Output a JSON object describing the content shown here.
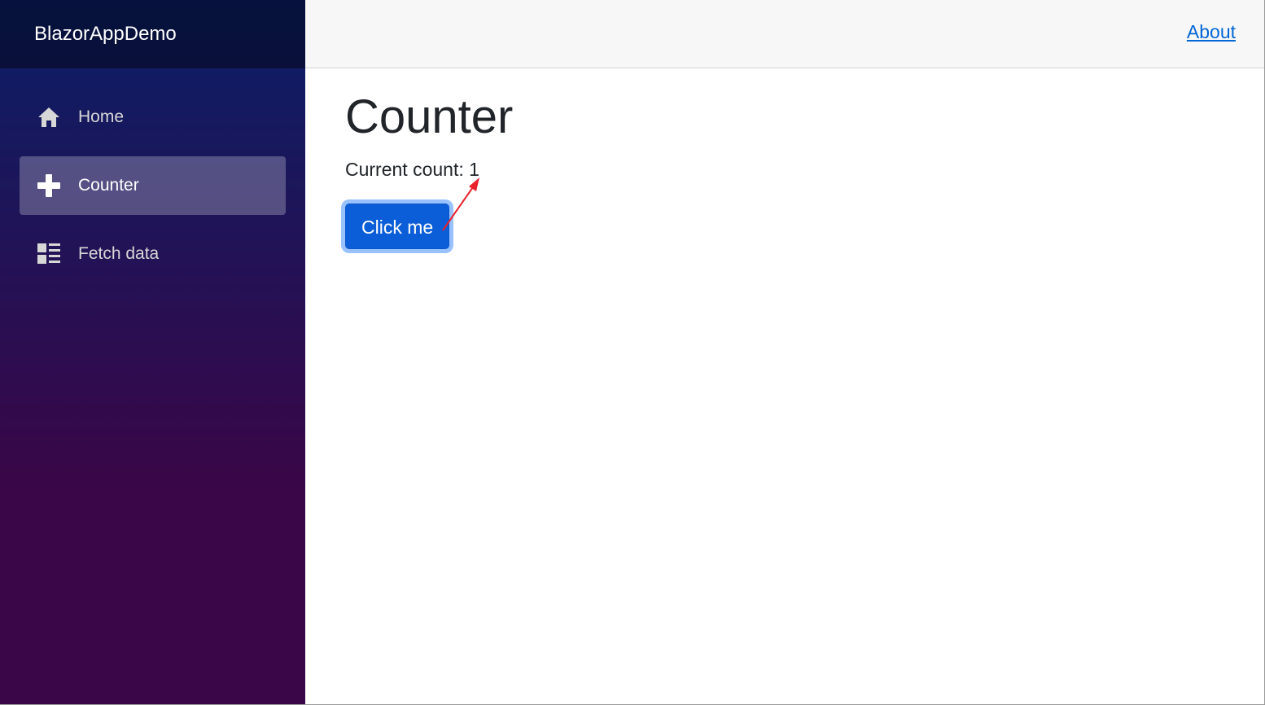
{
  "app": {
    "brand": "BlazorAppDemo"
  },
  "nav": {
    "items": [
      {
        "label": "Home",
        "icon": "home-icon",
        "active": false
      },
      {
        "label": "Counter",
        "icon": "plus-icon",
        "active": true
      },
      {
        "label": "Fetch data",
        "icon": "list-icon",
        "active": false
      }
    ]
  },
  "topbar": {
    "about_label": "About"
  },
  "main": {
    "title": "Counter",
    "count_label": "Current count: ",
    "count_value": "1",
    "button_label": "Click me"
  },
  "colors": {
    "sidebar_top": "#0a1f66",
    "sidebar_bottom": "#3a0647",
    "primary_button": "#0b5ed7",
    "link": "#0366d6",
    "annotation_arrow": "#e8212b"
  }
}
